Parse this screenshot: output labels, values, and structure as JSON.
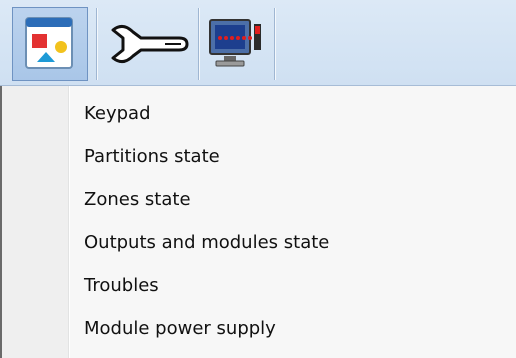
{
  "toolbar": {
    "buttons": [
      {
        "name": "main-window-button",
        "icon": "window-shapes-icon",
        "active": true
      },
      {
        "name": "settings-button",
        "icon": "wrench-icon",
        "active": false
      },
      {
        "name": "monitor-button",
        "icon": "monitor-modules-icon",
        "active": false
      }
    ]
  },
  "menu": {
    "items": [
      {
        "label": "Keypad"
      },
      {
        "label": "Partitions state"
      },
      {
        "label": "Zones state"
      },
      {
        "label": "Outputs and modules state"
      },
      {
        "label": "Troubles"
      },
      {
        "label": "Module power supply"
      }
    ]
  }
}
